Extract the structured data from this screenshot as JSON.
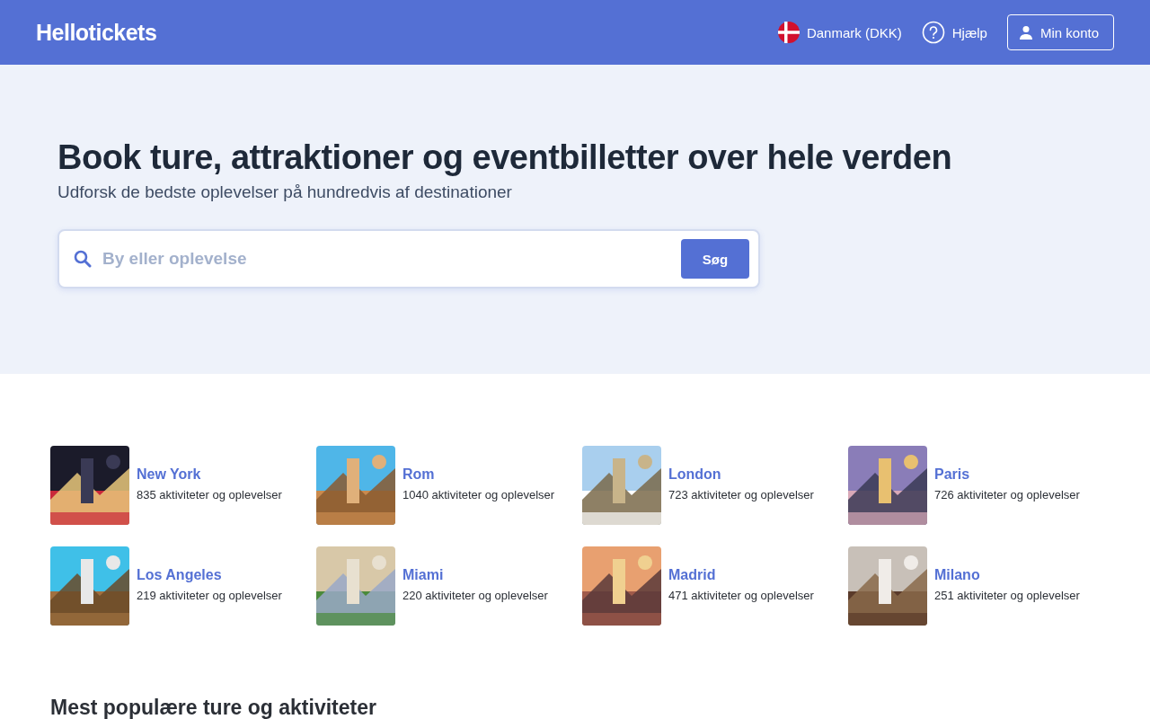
{
  "header": {
    "logo": "Hellotickets",
    "country": "Danmark (DKK)",
    "help": "Hjælp",
    "account": "Min konto"
  },
  "hero": {
    "title": "Book ture, attraktioner og eventbilletter over hele verden",
    "subtitle": "Udforsk de bedste oplevelser på hundredvis af destinationer",
    "search": {
      "placeholder": "By eller oplevelse",
      "button": "Søg"
    }
  },
  "destinations": [
    {
      "name": "New York",
      "count": "835 aktiviteter og oplevelser"
    },
    {
      "name": "Rom",
      "count": "1040 aktiviteter og oplevelser"
    },
    {
      "name": "London",
      "count": "723 aktiviteter og oplevelser"
    },
    {
      "name": "Paris",
      "count": "726 aktiviteter og oplevelser"
    },
    {
      "name": "Los Angeles",
      "count": "219 aktiviteter og oplevelser"
    },
    {
      "name": "Miami",
      "count": "220 aktiviteter og oplevelser"
    },
    {
      "name": "Madrid",
      "count": "471 aktiviteter og oplevelser"
    },
    {
      "name": "Milano",
      "count": "251 aktiviteter og oplevelser"
    }
  ],
  "section_title": "Mest populære ture og aktiviteter"
}
